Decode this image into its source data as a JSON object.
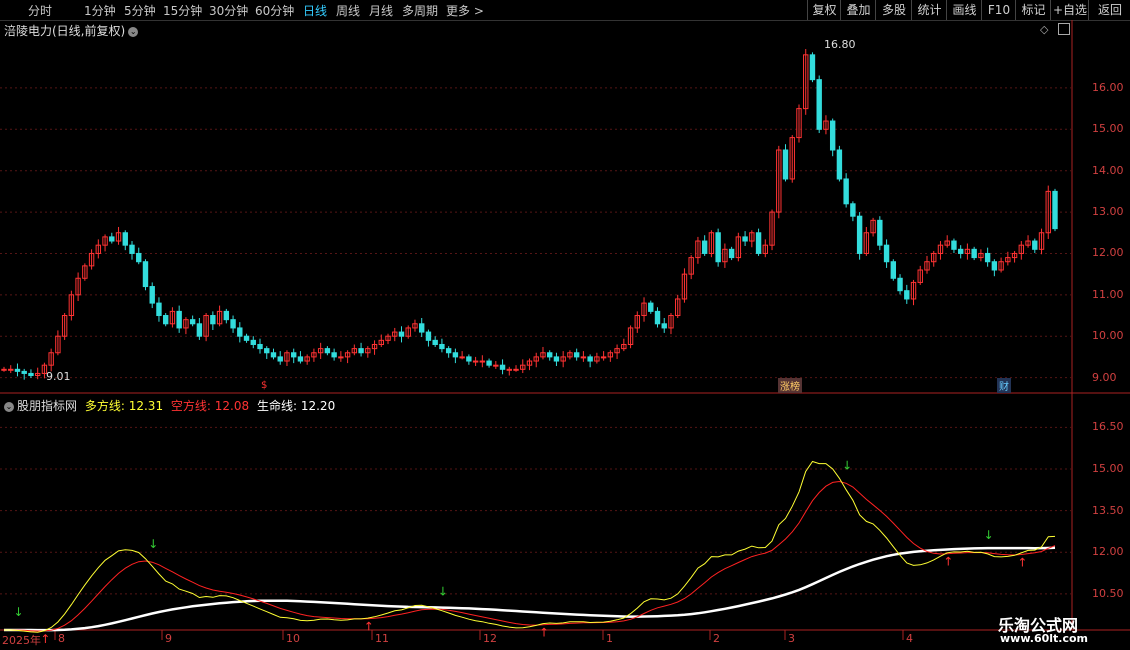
{
  "periods": [
    "分时",
    "1分钟",
    "5分钟",
    "15分钟",
    "30分钟",
    "60分钟",
    "日线",
    "周线",
    "月线",
    "多周期",
    "更多 >"
  ],
  "active_period": "日线",
  "tools": [
    "复权",
    "叠加",
    "多股",
    "统计",
    "画线",
    "F10",
    "标记",
    "+自选",
    "返回"
  ],
  "main": {
    "title": "涪陵电力(日线,前复权)",
    "high_label": "16.80",
    "low_label": "9.01",
    "yticks": [
      "16.00",
      "15.00",
      "14.00",
      "13.00",
      "12.00",
      "11.00",
      "10.00",
      "9.00"
    ],
    "badges": [
      "$",
      "涨榜",
      "财"
    ]
  },
  "indicator": {
    "name": "股朋指标网",
    "l1": "多方线:",
    "v1": "12.31",
    "l2": "空方线:",
    "v2": "12.08",
    "l3": "生命线:",
    "v3": "12.20",
    "yticks": [
      "16.50",
      "15.00",
      "13.50",
      "12.00",
      "10.50"
    ]
  },
  "xaxis": [
    "2025年",
    "8",
    "9",
    "10",
    "11",
    "12",
    "1",
    "2",
    "3",
    "4"
  ],
  "watermark": {
    "name": "乐淘公式网",
    "url": "www.60lt.com"
  },
  "colors": {
    "up": "#ff3333",
    "down": "#33dddd",
    "fast": "#ffff33",
    "slow": "#ff2222",
    "life": "#ffffff"
  },
  "chart_data": {
    "type": "candlestick",
    "ylim": [
      8.7,
      17.4
    ],
    "closes": [
      9.2,
      9.2,
      9.15,
      9.1,
      9.05,
      9.1,
      9.3,
      9.6,
      10.0,
      10.5,
      11.0,
      11.4,
      11.7,
      12.0,
      12.2,
      12.4,
      12.3,
      12.5,
      12.2,
      12.0,
      11.8,
      11.2,
      10.8,
      10.5,
      10.3,
      10.6,
      10.2,
      10.4,
      10.3,
      10.0,
      10.5,
      10.3,
      10.6,
      10.4,
      10.2,
      10.0,
      9.9,
      9.8,
      9.7,
      9.6,
      9.5,
      9.4,
      9.6,
      9.5,
      9.4,
      9.5,
      9.6,
      9.7,
      9.6,
      9.5,
      9.5,
      9.6,
      9.7,
      9.6,
      9.7,
      9.8,
      9.9,
      10.0,
      10.1,
      10.0,
      10.2,
      10.3,
      10.1,
      9.9,
      9.8,
      9.7,
      9.6,
      9.5,
      9.5,
      9.4,
      9.4,
      9.4,
      9.3,
      9.3,
      9.2,
      9.2,
      9.2,
      9.3,
      9.4,
      9.5,
      9.6,
      9.5,
      9.4,
      9.5,
      9.6,
      9.5,
      9.5,
      9.4,
      9.5,
      9.5,
      9.6,
      9.7,
      9.8,
      10.2,
      10.5,
      10.8,
      10.6,
      10.3,
      10.2,
      10.5,
      10.9,
      11.5,
      11.9,
      12.3,
      12.0,
      12.5,
      11.8,
      12.1,
      11.9,
      12.4,
      12.3,
      12.5,
      12.0,
      12.2,
      13.0,
      14.5,
      13.8,
      14.8,
      15.5,
      16.8,
      16.2,
      15.0,
      15.2,
      14.5,
      13.8,
      13.2,
      12.9,
      12.0,
      12.5,
      12.8,
      12.2,
      11.8,
      11.4,
      11.1,
      10.9,
      11.3,
      11.6,
      11.8,
      12.0,
      12.2,
      12.3,
      12.1,
      12.0,
      12.1,
      11.9,
      12.0,
      11.8,
      11.6,
      11.8,
      11.9,
      12.0,
      12.2,
      12.3,
      12.1,
      12.5,
      13.5,
      12.6
    ]
  }
}
